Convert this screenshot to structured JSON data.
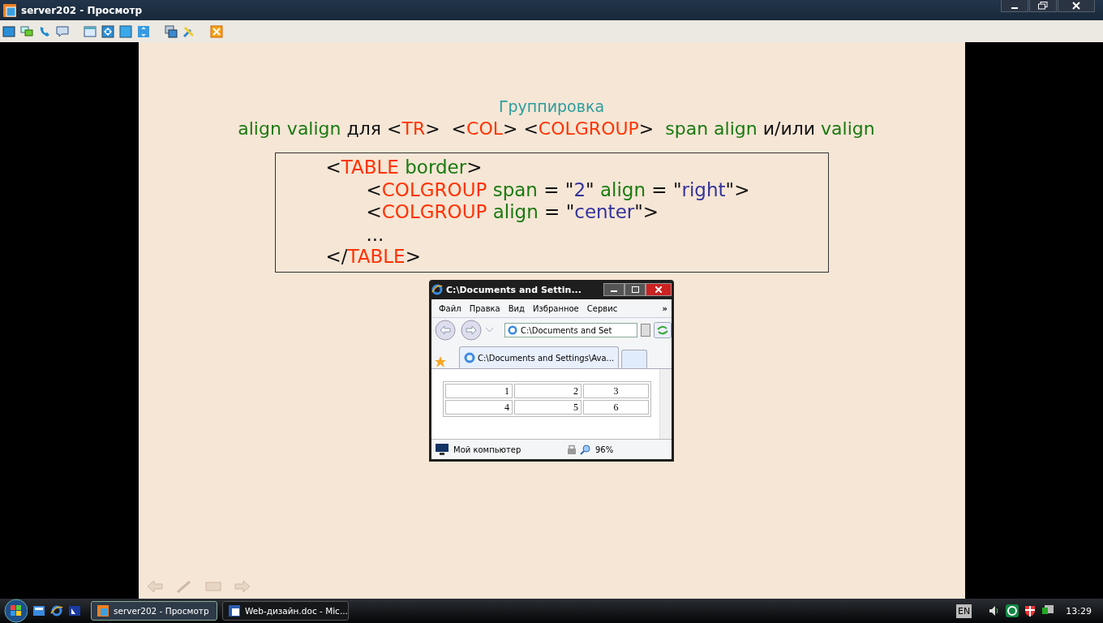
{
  "window": {
    "title": "server202 - Просмотр"
  },
  "slide": {
    "title": "Группировка",
    "subtitle": [
      {
        "kind": "attr",
        "text": "align valign"
      },
      {
        "kind": "plain",
        "text": " для <"
      },
      {
        "kind": "tag",
        "text": "TR"
      },
      {
        "kind": "plain",
        "text": ">  <"
      },
      {
        "kind": "tag",
        "text": "COL"
      },
      {
        "kind": "plain",
        "text": "> <"
      },
      {
        "kind": "tag",
        "text": "COLGROUP"
      },
      {
        "kind": "plain",
        "text": ">  "
      },
      {
        "kind": "attr",
        "text": "span align"
      },
      {
        "kind": "plain",
        "text": " и/или "
      },
      {
        "kind": "attr",
        "text": "valign"
      }
    ],
    "code": {
      "open": [
        {
          "kind": "plain",
          "text": "<"
        },
        {
          "kind": "tag",
          "text": "TABLE"
        },
        {
          "kind": "attr",
          "text": " border"
        },
        {
          "kind": "plain",
          "text": ">"
        }
      ],
      "children": [
        [
          {
            "kind": "plain",
            "text": "<"
          },
          {
            "kind": "tag",
            "text": "COLGROUP"
          },
          {
            "kind": "attr",
            "text": " span"
          },
          {
            "kind": "plain",
            "text": " = \""
          },
          {
            "kind": "value",
            "text": "2"
          },
          {
            "kind": "plain",
            "text": "\" "
          },
          {
            "kind": "attr",
            "text": "align"
          },
          {
            "kind": "plain",
            "text": " = \""
          },
          {
            "kind": "value",
            "text": "right"
          },
          {
            "kind": "plain",
            "text": "\">"
          }
        ],
        [
          {
            "kind": "plain",
            "text": "<"
          },
          {
            "kind": "tag",
            "text": "COLGROUP"
          },
          {
            "kind": "attr",
            "text": " align"
          },
          {
            "kind": "plain",
            "text": " = \""
          },
          {
            "kind": "value",
            "text": "center"
          },
          {
            "kind": "plain",
            "text": "\">"
          }
        ],
        [
          {
            "kind": "plain",
            "text": "..."
          }
        ]
      ],
      "close": [
        {
          "kind": "plain",
          "text": "</"
        },
        {
          "kind": "tag",
          "text": "TABLE"
        },
        {
          "kind": "plain",
          "text": ">"
        }
      ]
    },
    "browser": {
      "title": "C:\\Documents and Settin...",
      "menu": [
        "Файл",
        "Правка",
        "Вид",
        "Избранное",
        "Сервис"
      ],
      "menu_more": "»",
      "address": "C:\\Documents and Set",
      "tab": "C:\\Documents and Settings\\Ava...",
      "table": {
        "rows": [
          [
            "1",
            "2",
            "3"
          ],
          [
            "4",
            "5",
            "6"
          ]
        ]
      },
      "status": "Мой компьютер",
      "zoom": "96%"
    }
  },
  "taskbar": {
    "tasks": [
      {
        "label": "server202 - Просмотр",
        "selected": true
      },
      {
        "label": "Web-дизайн.doc - Mic...",
        "selected": false
      }
    ],
    "language": "EN",
    "clock": "13:29"
  }
}
